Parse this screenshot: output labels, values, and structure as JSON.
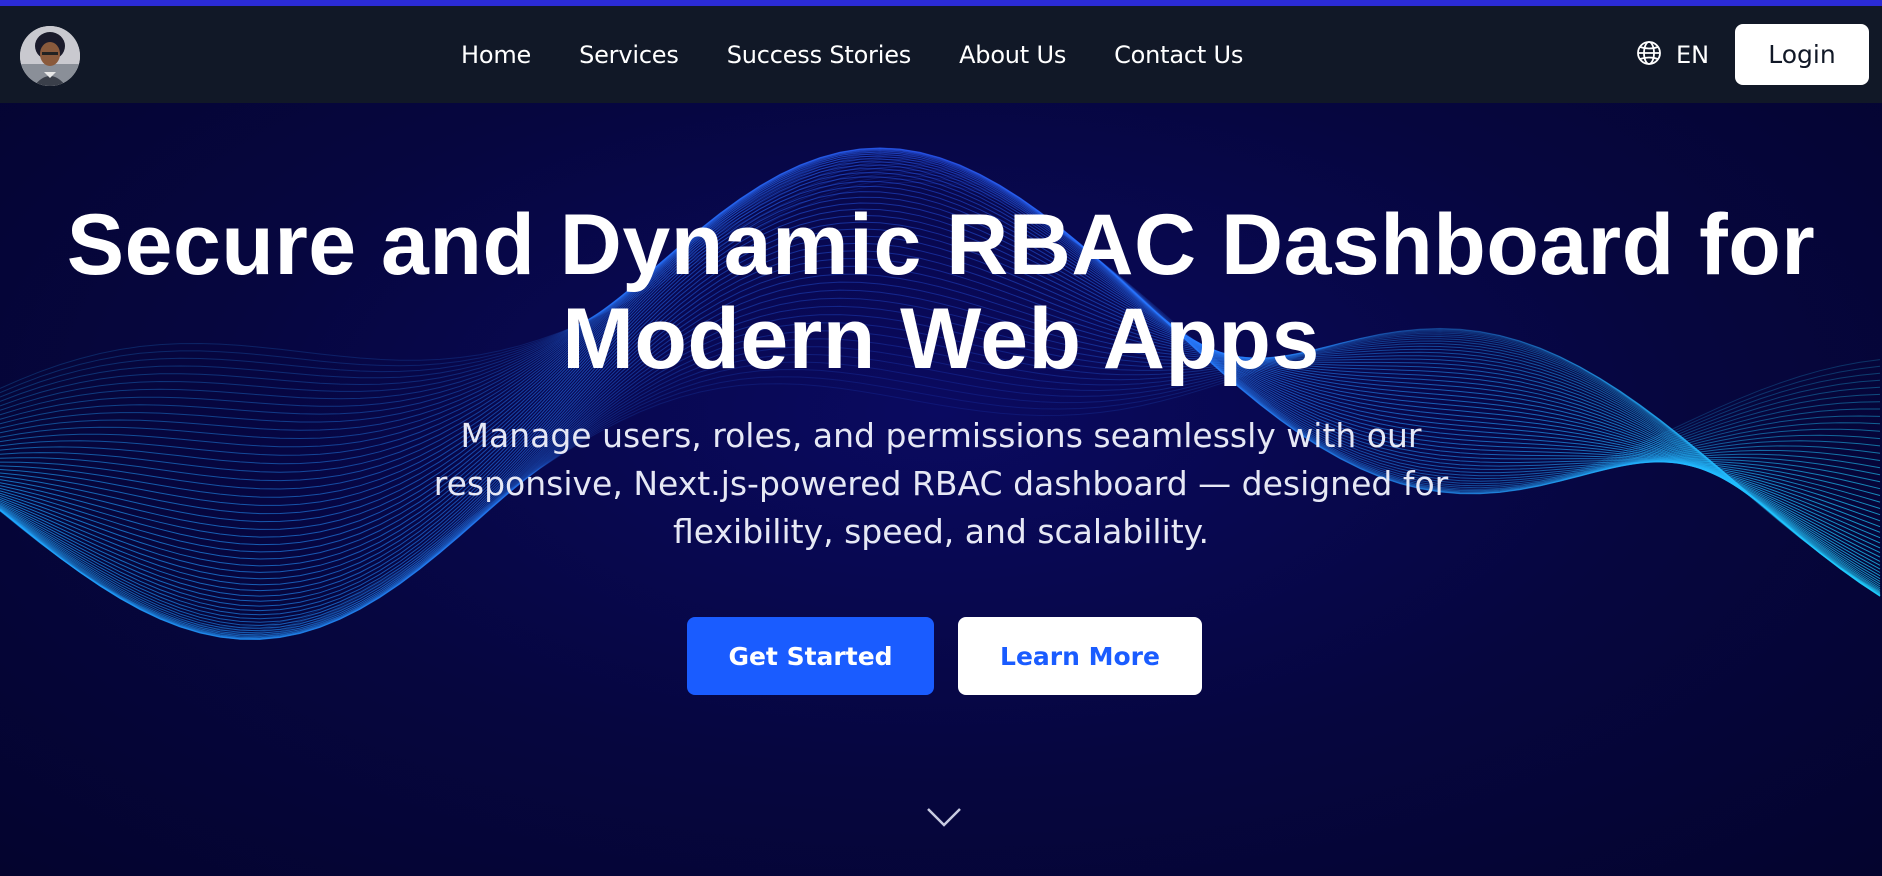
{
  "header": {
    "nav": [
      {
        "label": "Home"
      },
      {
        "label": "Services"
      },
      {
        "label": "Success Stories"
      },
      {
        "label": "About Us"
      },
      {
        "label": "Contact Us"
      }
    ],
    "language": "EN",
    "login_label": "Login"
  },
  "hero": {
    "title_line1": "Secure and Dynamic RBAC Dashboard for",
    "title_line2": "Modern Web Apps",
    "subtitle_line1": "Manage users, roles, and permissions seamlessly with our",
    "subtitle_line2": "responsive, Next.js-powered RBAC dashboard — designed for",
    "subtitle_line3": "flexibility, speed, and scalability.",
    "primary_cta": "Get Started",
    "secondary_cta": "Learn More"
  },
  "icons": {
    "language": "globe-icon",
    "scroll": "chevron-down-icon"
  },
  "colors": {
    "accent": "#1a5cff",
    "nav_bg": "#111827",
    "hero_bg": "#05053a",
    "wave": "#1fa8ff"
  }
}
